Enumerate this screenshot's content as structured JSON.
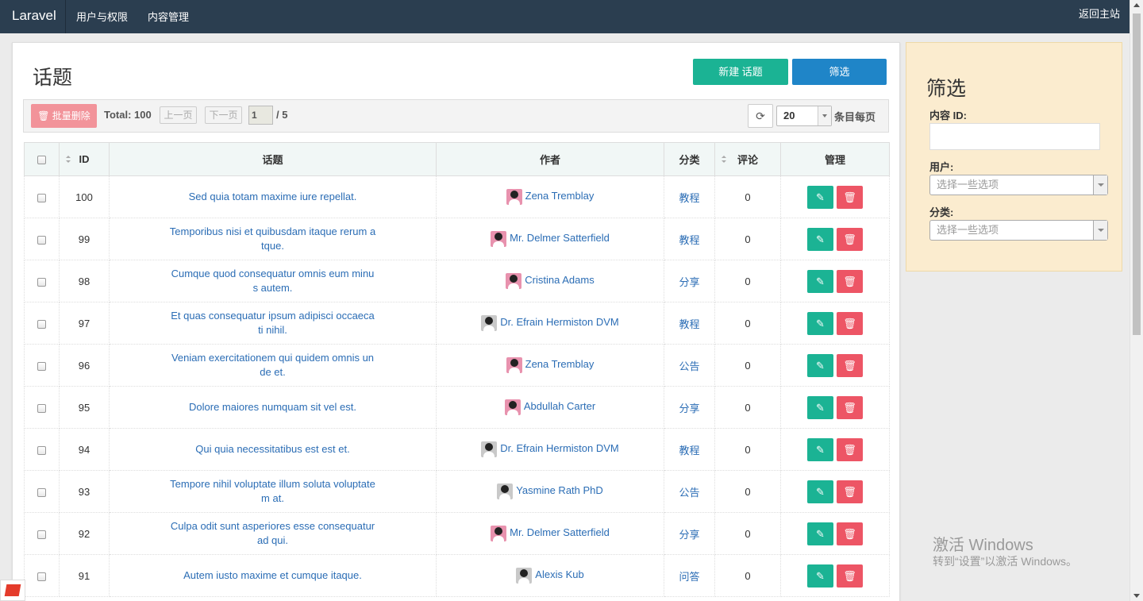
{
  "navbar": {
    "brand": "Laravel",
    "links": [
      "用户与权限",
      "内容管理"
    ],
    "home": "返回主站"
  },
  "page": {
    "title": "话题",
    "create_label": "新建 话题",
    "filter_label": "筛选"
  },
  "toolbar": {
    "batch_delete": "批量删除",
    "total": "Total: 100",
    "prev": "上一页",
    "next": "下一页",
    "page_value": "1",
    "page_total": "/ 5",
    "per_page_value": "20",
    "per_page_label": "条目每页"
  },
  "table": {
    "headers": [
      "ID",
      "话题",
      "作者",
      "分类",
      "评论",
      "管理"
    ],
    "rows": [
      {
        "id": "100",
        "title_lines": [
          "Sed quia totam maxime iure repellat."
        ],
        "author": "Zena Tremblay",
        "avatar": "pink",
        "category": "教程",
        "comments": "0"
      },
      {
        "id": "99",
        "title_lines": [
          "Temporibus nisi et quibusdam itaque rerum a",
          "tque."
        ],
        "author": "Mr. Delmer Satterfield",
        "avatar": "pink",
        "category": "教程",
        "comments": "0"
      },
      {
        "id": "98",
        "title_lines": [
          "Cumque quod consequatur omnis eum minu",
          "s autem."
        ],
        "author": "Cristina Adams",
        "avatar": "pink",
        "category": "分享",
        "comments": "0"
      },
      {
        "id": "97",
        "title_lines": [
          "Et quas consequatur ipsum adipisci occaeca",
          "ti nihil."
        ],
        "author": "Dr. Efrain Hermiston DVM",
        "avatar": "gray",
        "category": "教程",
        "comments": "0"
      },
      {
        "id": "96",
        "title_lines": [
          "Veniam exercitationem qui quidem omnis un",
          "de et."
        ],
        "author": "Zena Tremblay",
        "avatar": "pink",
        "category": "公告",
        "comments": "0"
      },
      {
        "id": "95",
        "title_lines": [
          "Dolore maiores numquam sit vel est."
        ],
        "author": "Abdullah Carter",
        "avatar": "pink",
        "category": "分享",
        "comments": "0"
      },
      {
        "id": "94",
        "title_lines": [
          "Qui quia necessitatibus est est et."
        ],
        "author": "Dr. Efrain Hermiston DVM",
        "avatar": "gray",
        "category": "教程",
        "comments": "0"
      },
      {
        "id": "93",
        "title_lines": [
          "Tempore nihil voluptate illum soluta voluptate",
          "m at."
        ],
        "author": "Yasmine Rath PhD",
        "avatar": "gray",
        "category": "公告",
        "comments": "0"
      },
      {
        "id": "92",
        "title_lines": [
          "Culpa odit sunt asperiores esse consequatur",
          "ad qui."
        ],
        "author": "Mr. Delmer Satterfield",
        "avatar": "pink",
        "category": "分享",
        "comments": "0"
      },
      {
        "id": "91",
        "title_lines": [
          "Autem iusto maxime et cumque itaque."
        ],
        "author": "Alexis Kub",
        "avatar": "gray",
        "category": "问答",
        "comments": "0"
      }
    ]
  },
  "filter": {
    "title": "筛选",
    "content_id_label": "内容 ID:",
    "user_label": "用户:",
    "user_placeholder": "选择一些选项",
    "category_label": "分类:",
    "category_placeholder": "选择一些选项"
  },
  "watermark": {
    "line1": "激活 Windows",
    "line2": "转到“设置”以激活 Windows。"
  },
  "colors": {
    "navbar": "#2b3e50",
    "primary_green": "#1bb394",
    "primary_blue": "#1f85c8",
    "danger": "#ed5565",
    "link": "#2b6db5",
    "filter_bg": "#fbeccf"
  },
  "icons": {
    "batch_delete": "trash-icon",
    "refresh": "refresh-icon",
    "edit": "brush-icon",
    "delete": "trash-icon"
  }
}
